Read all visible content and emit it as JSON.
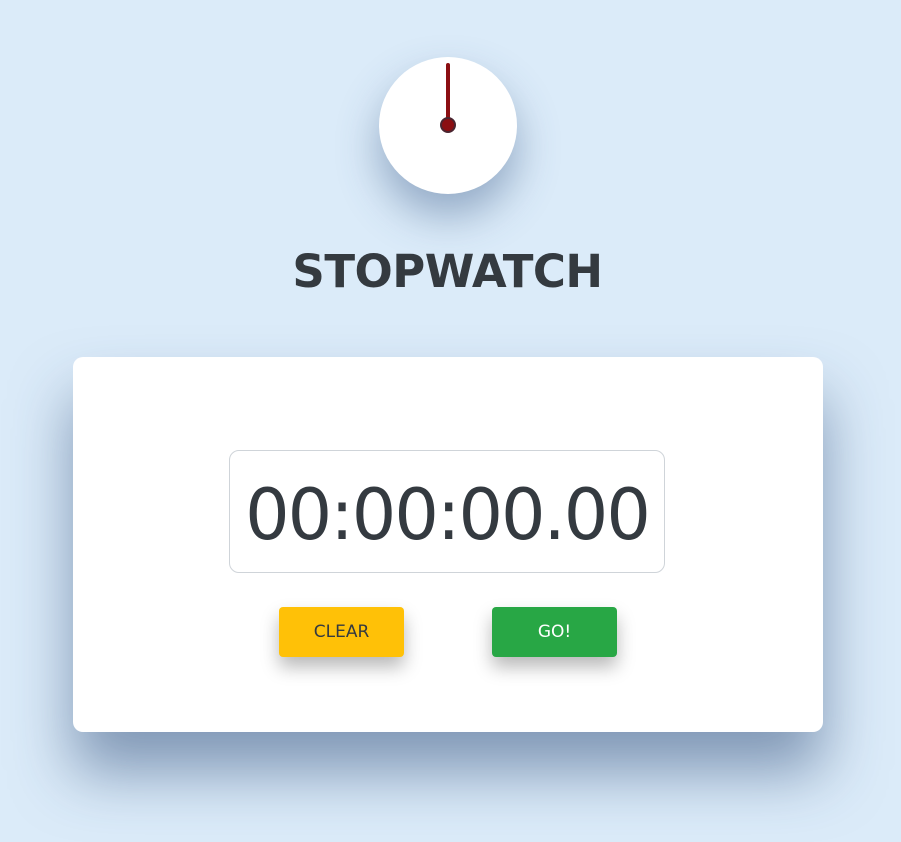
{
  "header": {
    "title": "STOPWATCH",
    "clock_icon": "stopwatch-clock-icon"
  },
  "timer": {
    "display": "00:00:00.00"
  },
  "controls": {
    "clear_label": "CLEAR",
    "go_label": "GO!"
  },
  "colors": {
    "background": "#dbebf9",
    "card": "#ffffff",
    "text": "#343a40",
    "clear_button": "#ffc107",
    "go_button": "#28a745",
    "clock_hand": "#8b0e12"
  }
}
